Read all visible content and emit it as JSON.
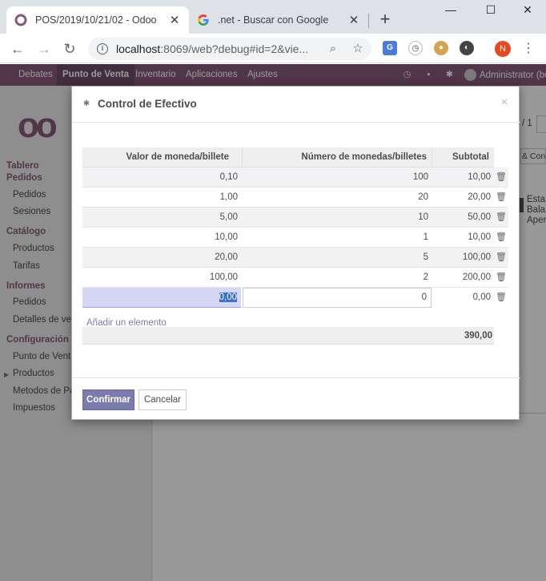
{
  "browser": {
    "tabs": [
      {
        "title": "POS/2019/10/21/02 - Odoo",
        "close": "✕"
      },
      {
        "title": ".net - Buscar con Google",
        "close": "✕"
      }
    ],
    "new_tab": "+",
    "window_controls": {
      "minimize": "—",
      "maximize": "☐",
      "close": "✕"
    },
    "url_host": "localhost",
    "url_rest": ":8069/web?debug#id=2&vie...",
    "profile_initial": "N",
    "nav_icons": {
      "back": "←",
      "forward": "→",
      "reload": "↻"
    },
    "kebab": "⋮"
  },
  "odoo": {
    "menu": [
      "Debates",
      "Punto de Venta",
      "Inventario",
      "Aplicaciones",
      "Ajustes"
    ],
    "user": "Administrator (bc",
    "logo": "oo",
    "sidebar": {
      "sections": [
        {
          "title": "Tablero",
          "items": []
        },
        {
          "title": "Pedidos",
          "items": [
            "Pedidos",
            "Sesiones"
          ]
        },
        {
          "title": "Catálogo",
          "items": [
            "Productos",
            "Tarifas"
          ]
        },
        {
          "title": "Informes",
          "items": [
            "Pedidos",
            "Detalles de ve"
          ]
        },
        {
          "title": "Configuración",
          "items": [
            "Punto de Vent",
            "Productos",
            "Metodos de Pa",
            "Impuestos"
          ]
        }
      ]
    },
    "pager": "/ 1",
    "control_button": "& Cont",
    "right_text": [
      "Esta",
      "Bala",
      "Aper"
    ]
  },
  "dialog": {
    "title": "Control de Efectivo",
    "close": "×",
    "columns": [
      "Valor de moneda/billete",
      "Número de monedas/billetes",
      "Subtotal"
    ],
    "rows": [
      {
        "value": "0,10",
        "count": "100",
        "subtotal": "10,00"
      },
      {
        "value": "1,00",
        "count": "20",
        "subtotal": "20,00"
      },
      {
        "value": "5,00",
        "count": "10",
        "subtotal": "50,00"
      },
      {
        "value": "10,00",
        "count": "1",
        "subtotal": "10,00"
      },
      {
        "value": "20,00",
        "count": "5",
        "subtotal": "100,00"
      },
      {
        "value": "100,00",
        "count": "2",
        "subtotal": "200,00"
      }
    ],
    "edit_row": {
      "value": "0,00",
      "count": "0",
      "subtotal": "0,00"
    },
    "add_line": "Añadir un elemento",
    "total": "390,00",
    "buttons": {
      "confirm": "Confirmar",
      "cancel": "Cancelar"
    }
  },
  "colors": {
    "odoo_primary": "#875a7b",
    "button_primary": "#7c7bad",
    "selection": "#3b6fd4"
  }
}
